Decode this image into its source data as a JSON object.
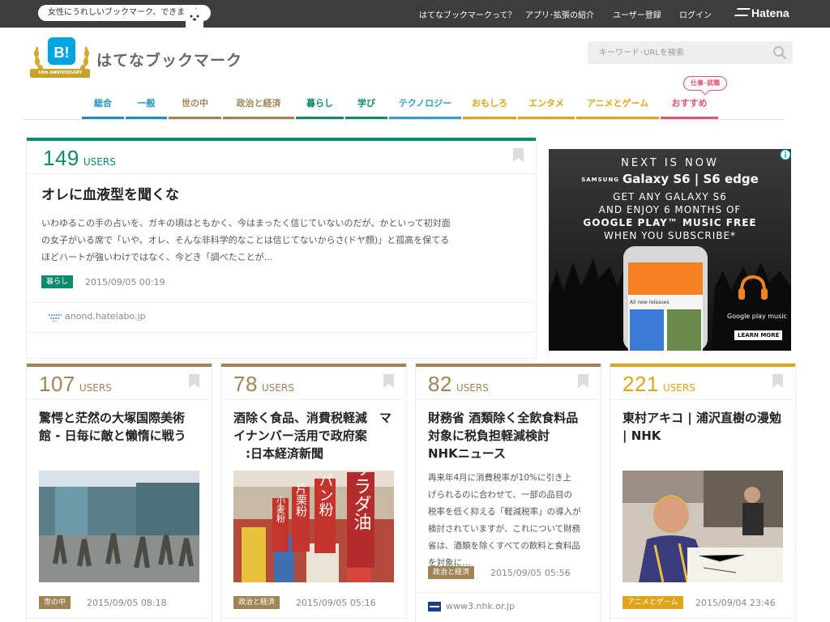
{
  "topbar": {
    "tagline": "女性にうれしいブックマーク、できました",
    "links": [
      "はてなブックマークって？",
      "アプリ･拡張の紹介",
      "ユーザー登録",
      "ログイン"
    ],
    "brand": "Hatena"
  },
  "header": {
    "logo_letter": "B!",
    "anniversary": "10th ANNIVERSARY",
    "title": "はてなブックマーク",
    "search_placeholder": "キーワード･URLを検索"
  },
  "categories": [
    {
      "label": "総合",
      "color": "#1d8fc2"
    },
    {
      "label": "一般",
      "color": "#1d8fc2"
    },
    {
      "label": "世の中",
      "color": "#a08456"
    },
    {
      "label": "政治と経済",
      "color": "#a08456"
    },
    {
      "label": "暮らし",
      "color": "#0e8a6d"
    },
    {
      "label": "学び",
      "color": "#0e8a6d"
    },
    {
      "label": "テクノロジー",
      "color": "#2ea0c8"
    },
    {
      "label": "おもしろ",
      "color": "#e0a41a"
    },
    {
      "label": "エンタメ",
      "color": "#e0a41a"
    },
    {
      "label": "アニメとゲーム",
      "color": "#e0a41a"
    },
    {
      "label": "おすすめ",
      "color": "#e0556f"
    }
  ],
  "recommend_badge": "仕事･就職",
  "featured": {
    "count": "149",
    "users_label": "USERS",
    "title": "オレに血液型を聞くな",
    "desc": [
      "いわゆるこの手の占いを、ガキの頃はともかく、今はまったく信じていないのだが、かといって初対面",
      "の女子がいる席で「いや、オレ、そんな非科学的なことは信じてないからさ(ドヤ顔)」と孤高を保てる",
      "ほどハートが強いわけではなく、今どき「調べたことが…"
    ],
    "tag": "暮らし",
    "date": "2015/09/05 00:19",
    "domain": "anond.hatelabo.jp",
    "color": "#0e8a6d"
  },
  "ad": {
    "line1": "NEXT IS NOW",
    "brand_samsung": "SAMSUNG",
    "model": "Galaxy S6 | S6 edge",
    "line3": "GET ANY GALAXY S6",
    "line4": "AND ENJOY 6 MONTHS OF",
    "line5": "GOOGLE PLAY™ MUSIC FREE",
    "line6": "WHEN YOU SUBSCRIBE*",
    "phone_text": "All new releases",
    "gp_label": "Google play music",
    "cta": "LEARN MORE"
  },
  "cards": [
    {
      "count": "107",
      "users_label": "USERS",
      "title": [
        "驚愕と茫然の大塚国際美術",
        "館 - 日毎に敵と懶惰に戦う"
      ],
      "tag": "世の中",
      "date": "2015/09/05 08:18",
      "color": "#a08456"
    },
    {
      "count": "78",
      "users_label": "USERS",
      "title": [
        "酒除く食品、消費税軽減　マ",
        "イナンバー活用で政府案",
        "　:日本経済新聞"
      ],
      "tag": "政治と経済",
      "date": "2015/09/05 05:16",
      "thumb_signs": [
        "サラダ油",
        "パン粉",
        "片栗粉",
        "小麦粉"
      ],
      "color": "#a08456"
    },
    {
      "count": "82",
      "users_label": "USERS",
      "title": [
        "財務省 酒類除く全飲食料品",
        "対象に税負担軽減検討",
        "NHKニュース"
      ],
      "desc": [
        "再来年4月に消費税率が10%に引き上",
        "げられるのに合わせて、一部の品目の",
        "税率を低く抑える「軽減税率」の導入が",
        "検討されていますが、これについて財務",
        "省は、酒類を除くすべての飲料と食料品",
        "を対象に…"
      ],
      "tag": "政治と経済",
      "date": "2015/09/05 05:56",
      "domain": "www3.nhk.or.jp",
      "color": "#a08456"
    },
    {
      "count": "221",
      "users_label": "USERS",
      "title": [
        "東村アキコ | 浦沢直樹の漫勉",
        "| NHK"
      ],
      "tag": "アニメとゲーム",
      "date": "2015/09/04 23:46",
      "color": "#e0a41a"
    }
  ]
}
